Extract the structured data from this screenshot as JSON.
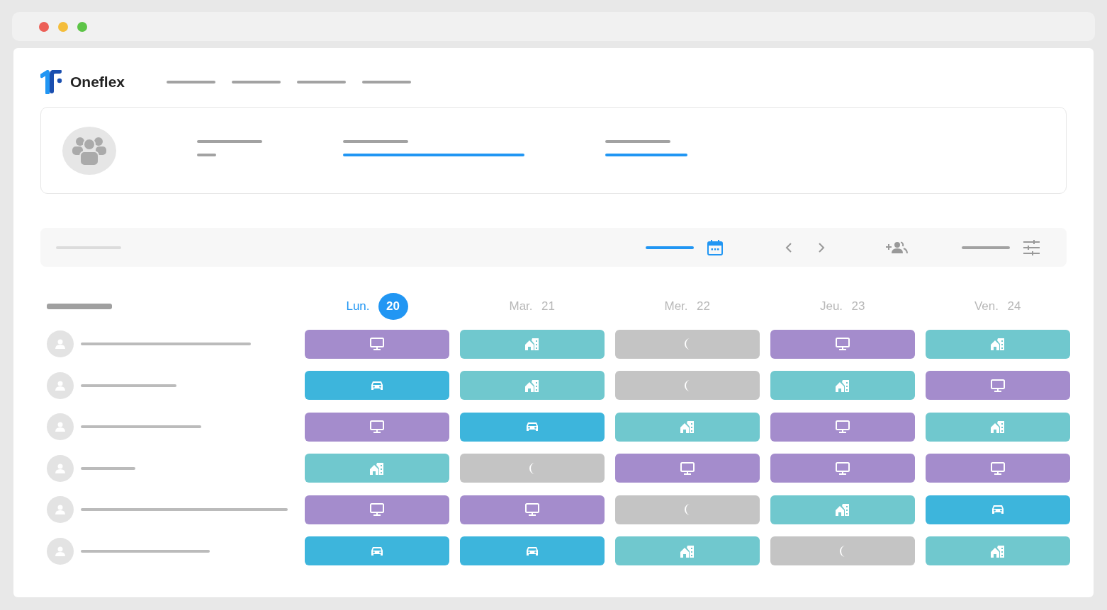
{
  "brand": {
    "name": "Oneflex"
  },
  "days": [
    {
      "label": "Lun.",
      "date": "20",
      "selected": true
    },
    {
      "label": "Mar.",
      "date": "21",
      "selected": false
    },
    {
      "label": "Mer.",
      "date": "22",
      "selected": false
    },
    {
      "label": "Jeu.",
      "date": "23",
      "selected": false
    },
    {
      "label": "Ven.",
      "date": "24",
      "selected": false
    }
  ],
  "rows": [
    {
      "cells": [
        {
          "kind": "remote"
        },
        {
          "kind": "office"
        },
        {
          "kind": "off"
        },
        {
          "kind": "remote"
        },
        {
          "kind": "office"
        }
      ]
    },
    {
      "cells": [
        {
          "kind": "travel"
        },
        {
          "kind": "office"
        },
        {
          "kind": "off"
        },
        {
          "kind": "office"
        },
        {
          "kind": "remote"
        }
      ]
    },
    {
      "cells": [
        {
          "kind": "remote"
        },
        {
          "kind": "travel"
        },
        {
          "kind": "office"
        },
        {
          "kind": "remote"
        },
        {
          "kind": "office"
        }
      ]
    },
    {
      "cells": [
        {
          "kind": "office"
        },
        {
          "kind": "off"
        },
        {
          "kind": "remote"
        },
        {
          "kind": "remote"
        },
        {
          "kind": "remote"
        }
      ]
    },
    {
      "cells": [
        {
          "kind": "remote"
        },
        {
          "kind": "remote"
        },
        {
          "kind": "off"
        },
        {
          "kind": "office"
        },
        {
          "kind": "travel"
        }
      ]
    },
    {
      "cells": [
        {
          "kind": "travel"
        },
        {
          "kind": "travel"
        },
        {
          "kind": "office"
        },
        {
          "kind": "off"
        },
        {
          "kind": "office"
        }
      ]
    }
  ]
}
